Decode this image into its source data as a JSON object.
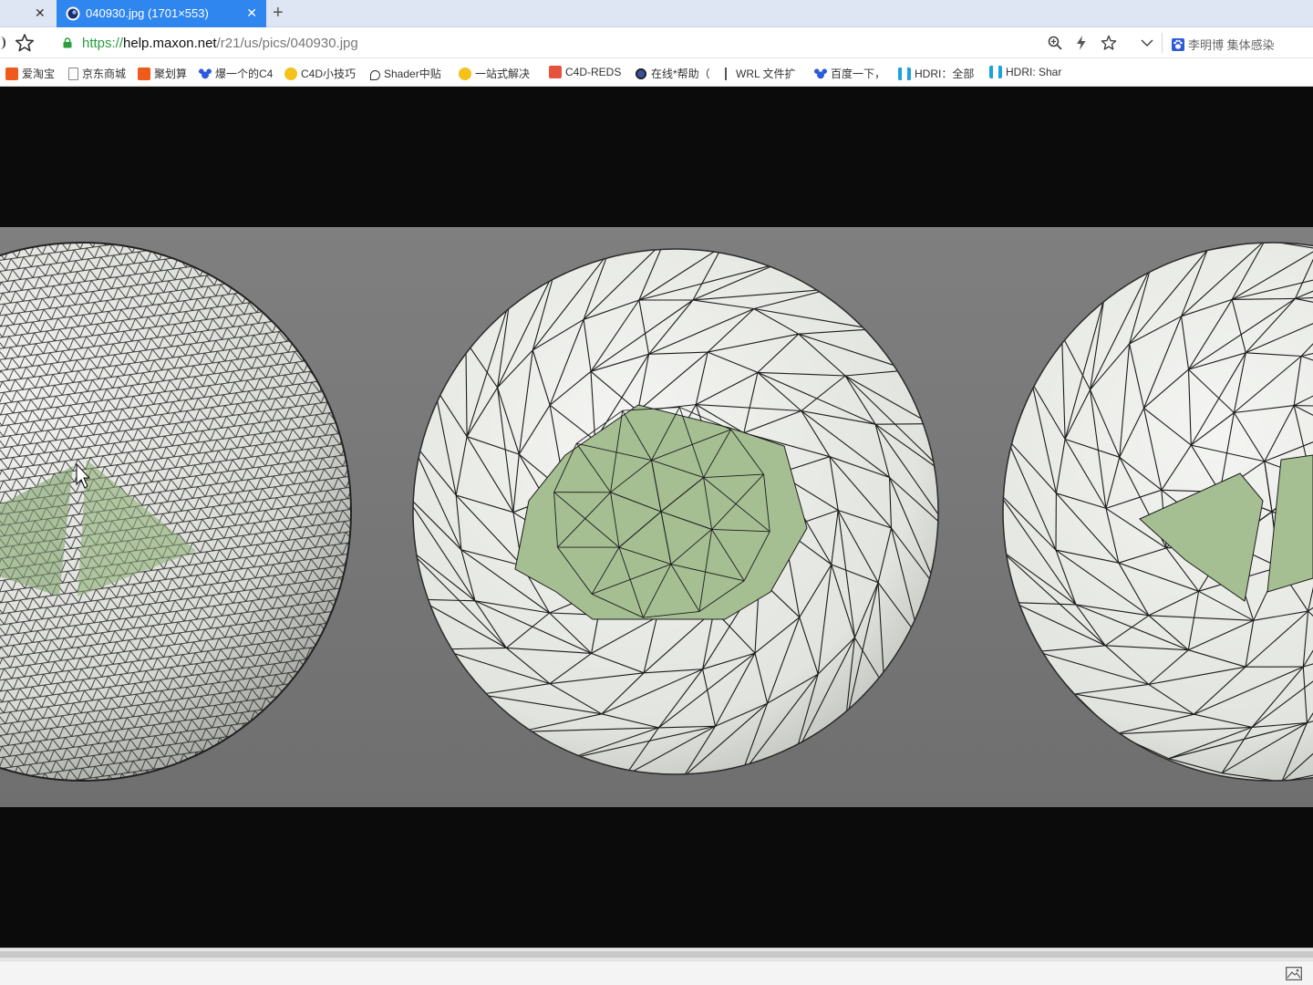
{
  "tabs": [
    {
      "title": "",
      "close": "✕",
      "state": "inactive"
    },
    {
      "title": "040930.jpg (1701×553)",
      "close": "✕",
      "state": "active",
      "favicon": "cinema4d-icon"
    }
  ],
  "new_tab_label": "+",
  "address": {
    "scheme": "https://",
    "host": "help.maxon.net",
    "path": "/r21/us/pics/040930.jpg"
  },
  "hot_search": "李明博 集体感染",
  "bookmarks": [
    {
      "label": "爱淘宝",
      "icon": "taobao"
    },
    {
      "label": "京东商城",
      "icon": "page"
    },
    {
      "label": "聚划算",
      "icon": "taobao"
    },
    {
      "label": "爆一个的C4",
      "icon": "baidu"
    },
    {
      "label": "C4D小技巧",
      "icon": "c4dz"
    },
    {
      "label": "Shader中贴",
      "icon": "pen"
    },
    {
      "label": "一站式解决",
      "icon": "c4dz"
    },
    {
      "label": "C4D-REDS",
      "icon": "jian"
    },
    {
      "label": "在线*帮助（",
      "icon": "c4dlogo"
    },
    {
      "label": "WRL 文件扩",
      "icon": "wrl"
    },
    {
      "label": "百度一下，",
      "icon": "baidu"
    },
    {
      "label": "HDRI：全部",
      "icon": "hdri"
    },
    {
      "label": "HDRI: Shar",
      "icon": "hdri"
    }
  ],
  "image": {
    "description_icon": "image-icon",
    "colors": {
      "background": "#777777",
      "mesh_fill": "#e8ebe6",
      "hole_fill": "#a8c196",
      "edge": "#1a1a1a",
      "frame": "#0b0b0b"
    }
  }
}
